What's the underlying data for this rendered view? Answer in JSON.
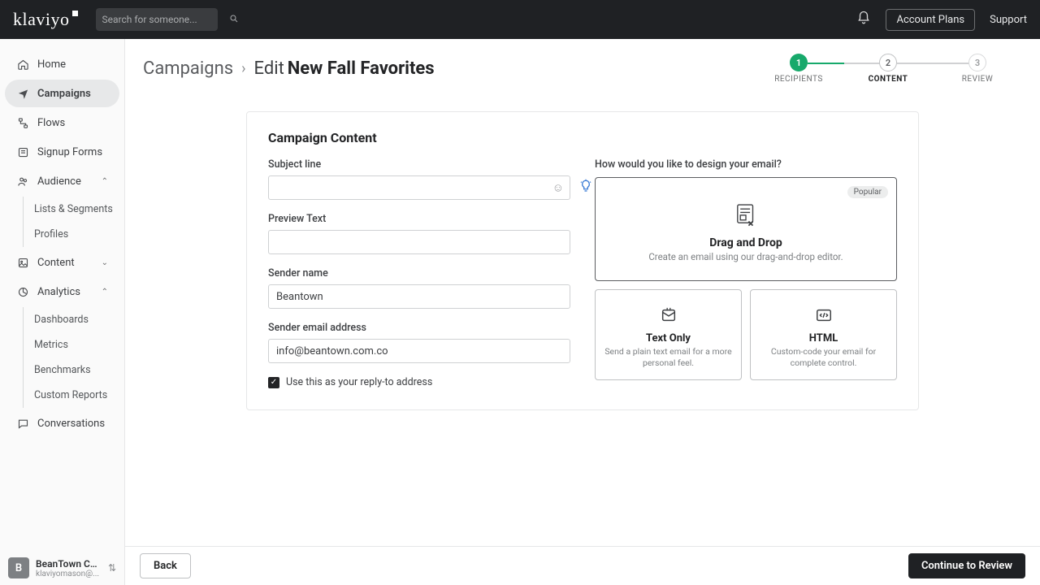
{
  "header": {
    "logo": "klaviyo",
    "search_placeholder": "Search for someone...",
    "account_plans": "Account Plans",
    "support": "Support"
  },
  "sidebar": {
    "items": [
      {
        "label": "Home"
      },
      {
        "label": "Campaigns"
      },
      {
        "label": "Flows"
      },
      {
        "label": "Signup Forms"
      },
      {
        "label": "Audience"
      },
      {
        "label": "Content"
      },
      {
        "label": "Analytics"
      },
      {
        "label": "Conversations"
      }
    ],
    "audience_children": [
      {
        "label": "Lists & Segments"
      },
      {
        "label": "Profiles"
      }
    ],
    "analytics_children": [
      {
        "label": "Dashboards"
      },
      {
        "label": "Metrics"
      },
      {
        "label": "Benchmarks"
      },
      {
        "label": "Custom Reports"
      }
    ],
    "account": {
      "initial": "B",
      "name": "BeanTown Co...",
      "email": "klaviyomason@..."
    }
  },
  "breadcrumb": {
    "root": "Campaigns",
    "action": "Edit",
    "title": "New Fall Favorites"
  },
  "stepper": {
    "steps": [
      {
        "num": "1",
        "label": "RECIPIENTS"
      },
      {
        "num": "2",
        "label": "CONTENT"
      },
      {
        "num": "3",
        "label": "REVIEW"
      }
    ]
  },
  "card": {
    "title": "Campaign Content",
    "subject_label": "Subject line",
    "subject_value": "",
    "preview_label": "Preview Text",
    "preview_value": "",
    "sender_name_label": "Sender name",
    "sender_name_value": "Beantown",
    "sender_email_label": "Sender email address",
    "sender_email_value": "info@beantown.com.co",
    "replyto_label": "Use this as your reply-to address",
    "design_question": "How would you like to design your email?",
    "popular_badge": "Popular",
    "options": {
      "drag": {
        "title": "Drag and Drop",
        "sub": "Create an email using our drag-and-drop editor."
      },
      "text": {
        "title": "Text Only",
        "sub": "Send a plain text email for a more personal feel."
      },
      "html": {
        "title": "HTML",
        "sub": "Custom-code your email for complete control."
      }
    }
  },
  "footer": {
    "back": "Back",
    "continue": "Continue to Review"
  }
}
